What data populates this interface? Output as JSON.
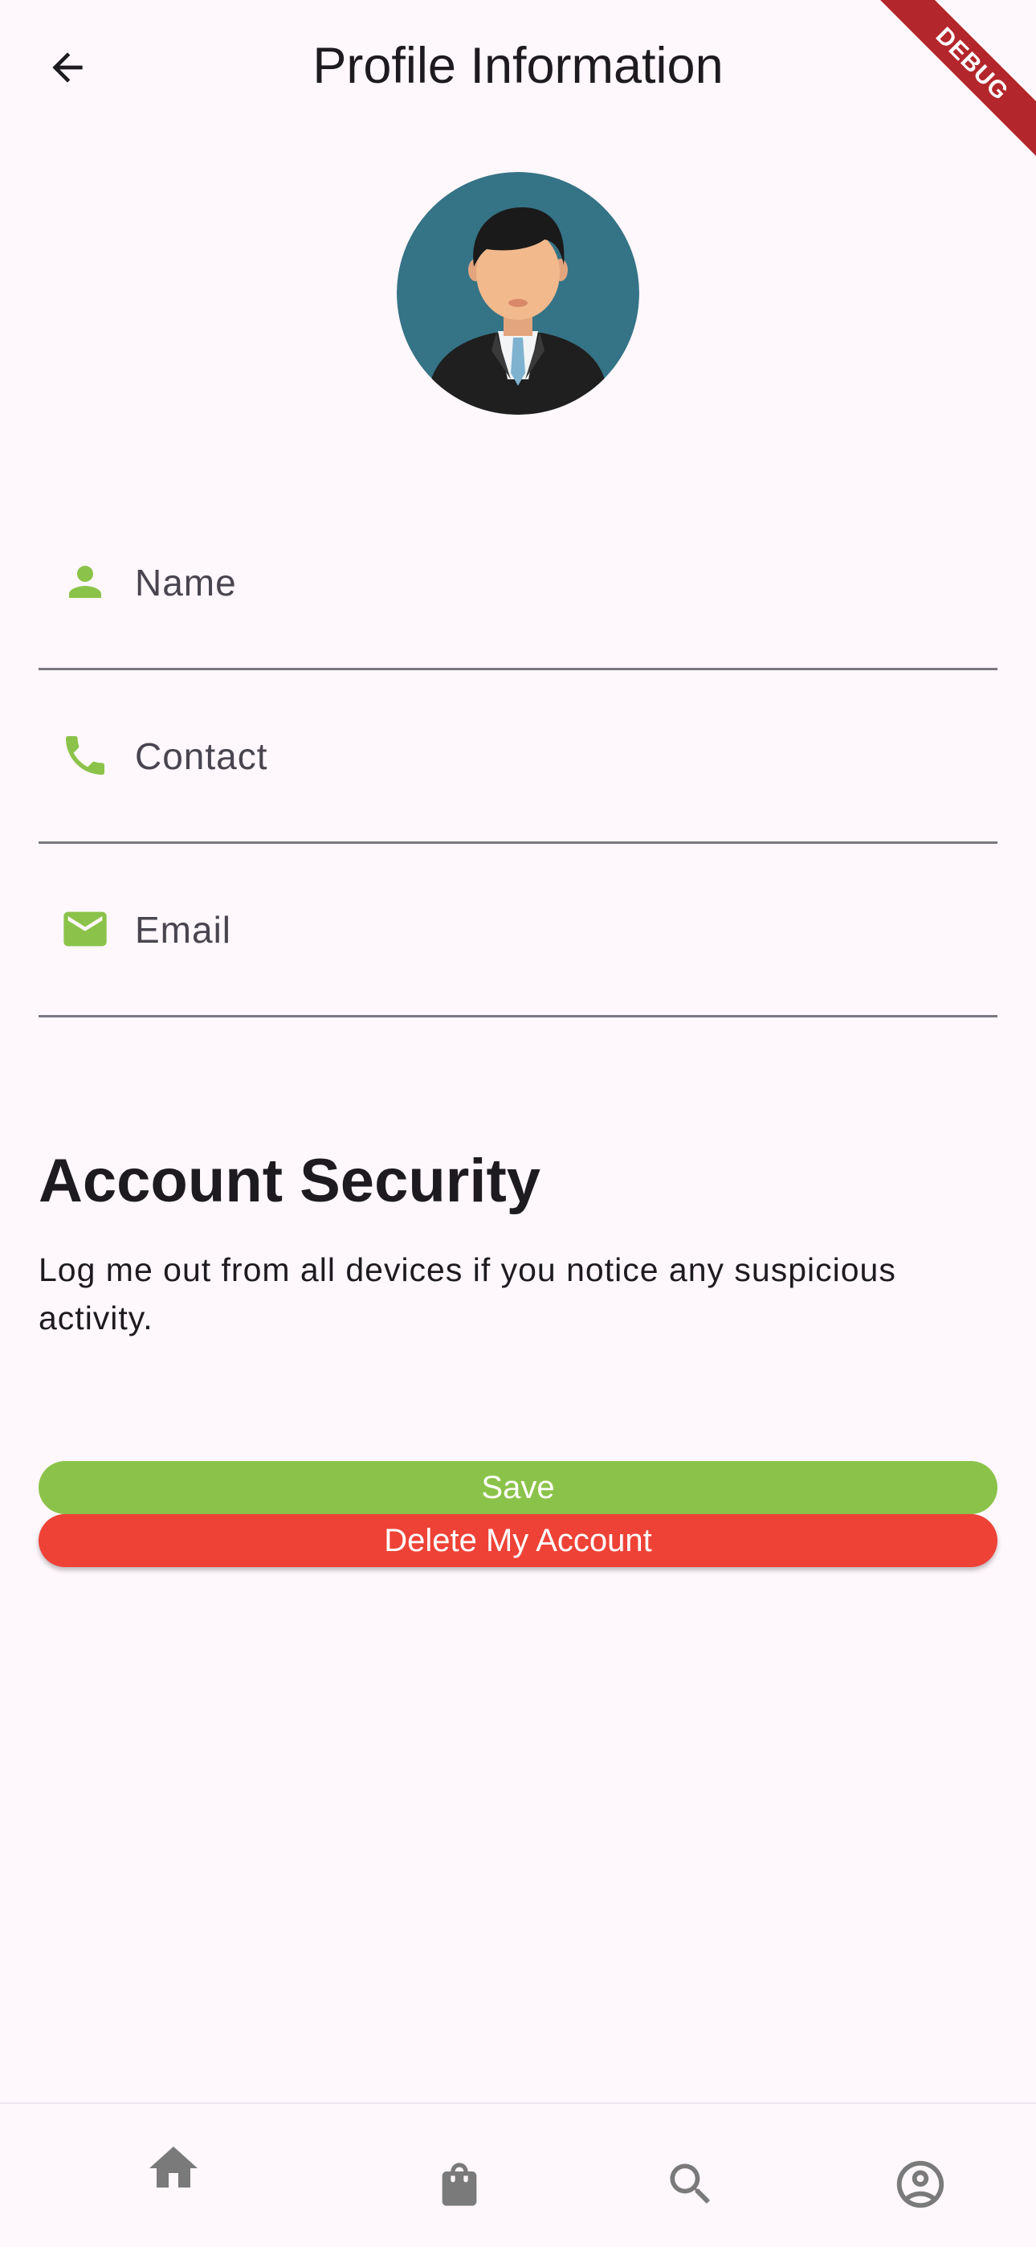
{
  "header": {
    "title": "Profile Information",
    "back_icon": "arrow-back-icon"
  },
  "debug_banner": "DEBUG",
  "avatar": {
    "icon": "user-avatar-illustration"
  },
  "form": {
    "name": {
      "placeholder": "Name",
      "value": "",
      "icon": "person-icon"
    },
    "contact": {
      "placeholder": "Contact",
      "value": "",
      "icon": "phone-icon"
    },
    "email": {
      "placeholder": "Email",
      "value": "",
      "icon": "mail-icon"
    },
    "icon_color": "#8BC34A"
  },
  "security": {
    "title": "Account Security",
    "description": "Log me out from all devices if you notice any suspicious activity."
  },
  "buttons": {
    "save": {
      "label": "Save",
      "color": "#8BC34A"
    },
    "delete": {
      "label": "Delete My Account",
      "color": "#EE4237"
    }
  },
  "bottom_nav": {
    "items": [
      {
        "icon": "home-icon"
      },
      {
        "icon": "shopping-bag-icon"
      },
      {
        "icon": "search-icon"
      },
      {
        "icon": "account-circle-icon"
      }
    ],
    "icon_color": "#7A7A7A"
  }
}
